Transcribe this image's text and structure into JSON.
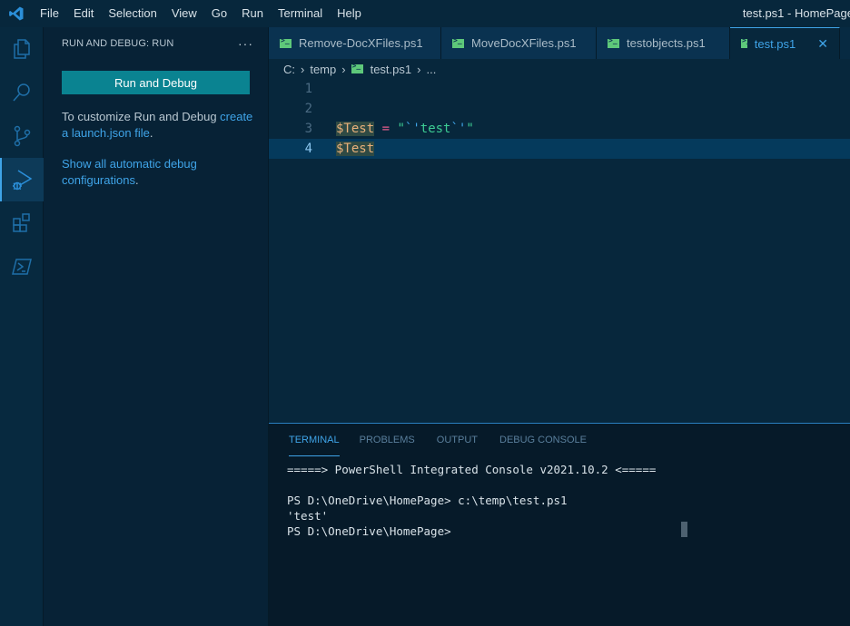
{
  "titlebar": {
    "menu": [
      "File",
      "Edit",
      "Selection",
      "View",
      "Go",
      "Run",
      "Terminal",
      "Help"
    ],
    "window_title": "test.ps1 - HomePage"
  },
  "activitybar": {
    "items": [
      {
        "name": "explorer",
        "icon": "files-icon"
      },
      {
        "name": "search",
        "icon": "search-icon"
      },
      {
        "name": "source-control",
        "icon": "source-control-icon"
      },
      {
        "name": "run-and-debug",
        "icon": "run-debug-icon",
        "active": true
      },
      {
        "name": "extensions",
        "icon": "extensions-icon"
      },
      {
        "name": "powershell",
        "icon": "powershell-icon"
      }
    ]
  },
  "sidebar": {
    "title": "RUN AND DEBUG: RUN",
    "more": "···",
    "run_button": "Run and Debug",
    "text1": "To customize Run and Debug ",
    "link1": "create a launch.json file",
    "text1_end": ".",
    "link2": "Show all automatic debug configurations",
    "text2_end": "."
  },
  "tabs": [
    {
      "label": "Remove-DocXFiles.ps1",
      "active": false
    },
    {
      "label": "MoveDocXFiles.ps1",
      "active": false
    },
    {
      "label": "testobjects.ps1",
      "active": false
    },
    {
      "label": "test.ps1",
      "active": true
    }
  ],
  "breadcrumb": [
    "C:",
    "temp",
    "test.ps1",
    "..."
  ],
  "editor": {
    "lines": [
      {
        "n": "1",
        "code": ""
      },
      {
        "n": "2",
        "code": ""
      },
      {
        "n": "3",
        "var": "$Test",
        "op": "=",
        "str_open": "\"",
        "esc1": "`'",
        "str_mid": "test",
        "esc2": "`'",
        "str_close": "\""
      },
      {
        "n": "4",
        "var": "$Test"
      }
    ],
    "current_line": 4
  },
  "panel": {
    "tabs": [
      "TERMINAL",
      "PROBLEMS",
      "OUTPUT",
      "DEBUG CONSOLE"
    ],
    "active_tab": "TERMINAL",
    "terminal_lines": [
      "=====> PowerShell Integrated Console v2021.10.2 <=====",
      "",
      "PS D:\\OneDrive\\HomePage> c:\\temp\\test.ps1",
      "'test'",
      "PS D:\\OneDrive\\HomePage>"
    ]
  }
}
